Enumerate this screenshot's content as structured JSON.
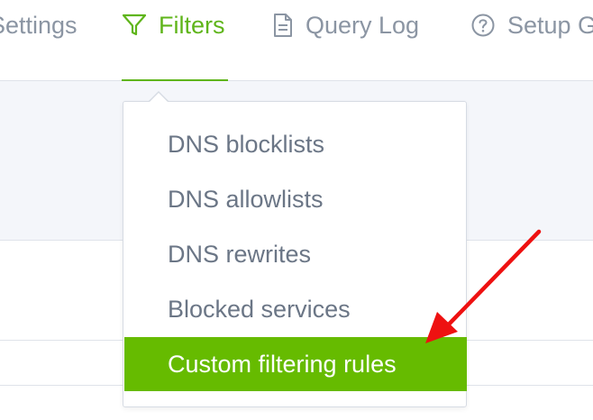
{
  "nav": {
    "items": [
      {
        "label": "Settings",
        "icon": "none"
      },
      {
        "label": "Filters",
        "icon": "filter-icon",
        "active": true
      },
      {
        "label": "Query Log",
        "icon": "document-icon"
      },
      {
        "label": "Setup G",
        "icon": "help-circle-icon"
      }
    ]
  },
  "dropdown": {
    "items": [
      {
        "label": "DNS blocklists"
      },
      {
        "label": "DNS allowlists"
      },
      {
        "label": "DNS rewrites"
      },
      {
        "label": "Blocked services"
      },
      {
        "label": "Custom filtering rules",
        "highlighted": true
      }
    ]
  },
  "colors": {
    "accent": "#5fb51a",
    "highlight": "#66bb00",
    "muted_text": "#8b95a3",
    "annotation_arrow": "#ee1111"
  }
}
